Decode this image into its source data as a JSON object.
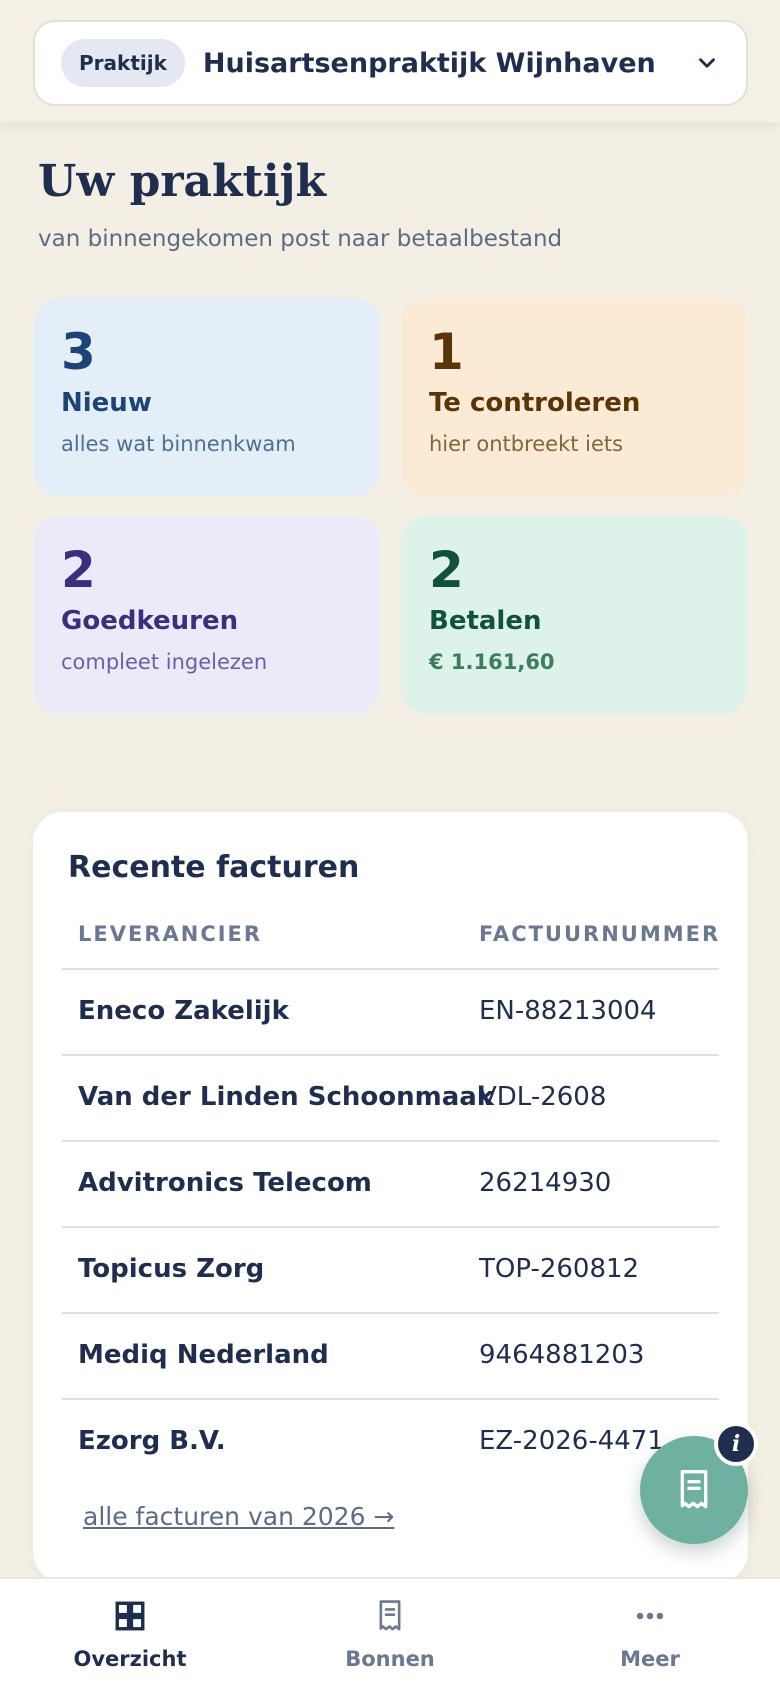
{
  "practice": {
    "pill_label": "Praktijk",
    "name": "Huisartsenpraktijk Wijnhaven"
  },
  "header": {
    "title": "Uw praktijk",
    "subtitle": "van binnengekomen post naar betaalbestand"
  },
  "stats": [
    {
      "count": "3",
      "label": "Nieuw",
      "sub": "alles wat binnenkwam"
    },
    {
      "count": "1",
      "label": "Te controleren",
      "sub": "hier ontbreekt iets"
    },
    {
      "count": "2",
      "label": "Goedkeuren",
      "sub": "compleet ingelezen"
    },
    {
      "count": "2",
      "label": "Betalen",
      "sub": "€ 1.161,60"
    }
  ],
  "invoices": {
    "title": "Recente facturen",
    "columns": [
      "LEVERANCIER",
      "FACTUURNUMMER"
    ],
    "rows": [
      {
        "supplier": "Eneco Zakelijk",
        "number": "EN-88213004"
      },
      {
        "supplier": "Van der Linden Schoonmaak",
        "number": "VDL-2608"
      },
      {
        "supplier": "Advitronics Telecom",
        "number": "26214930"
      },
      {
        "supplier": "Topicus Zorg",
        "number": "TOP-260812"
      },
      {
        "supplier": "Mediq Nederland",
        "number": "9464881203"
      },
      {
        "supplier": "Ezorg B.V.",
        "number": "EZ-2026-4471"
      }
    ],
    "all_link": "alle facturen van 2026 →"
  },
  "fab": {
    "badge": "i",
    "icon": "receipt-icon"
  },
  "nav": [
    {
      "label": "Overzicht",
      "icon": "grid-icon",
      "active": true
    },
    {
      "label": "Bonnen",
      "icon": "receipt-icon",
      "active": false
    },
    {
      "label": "Meer",
      "icon": "more-icon",
      "active": false
    }
  ],
  "colors": {
    "background": "#f4efe4",
    "ink": "#1f2d4f",
    "fab": "#6fb1a0"
  }
}
